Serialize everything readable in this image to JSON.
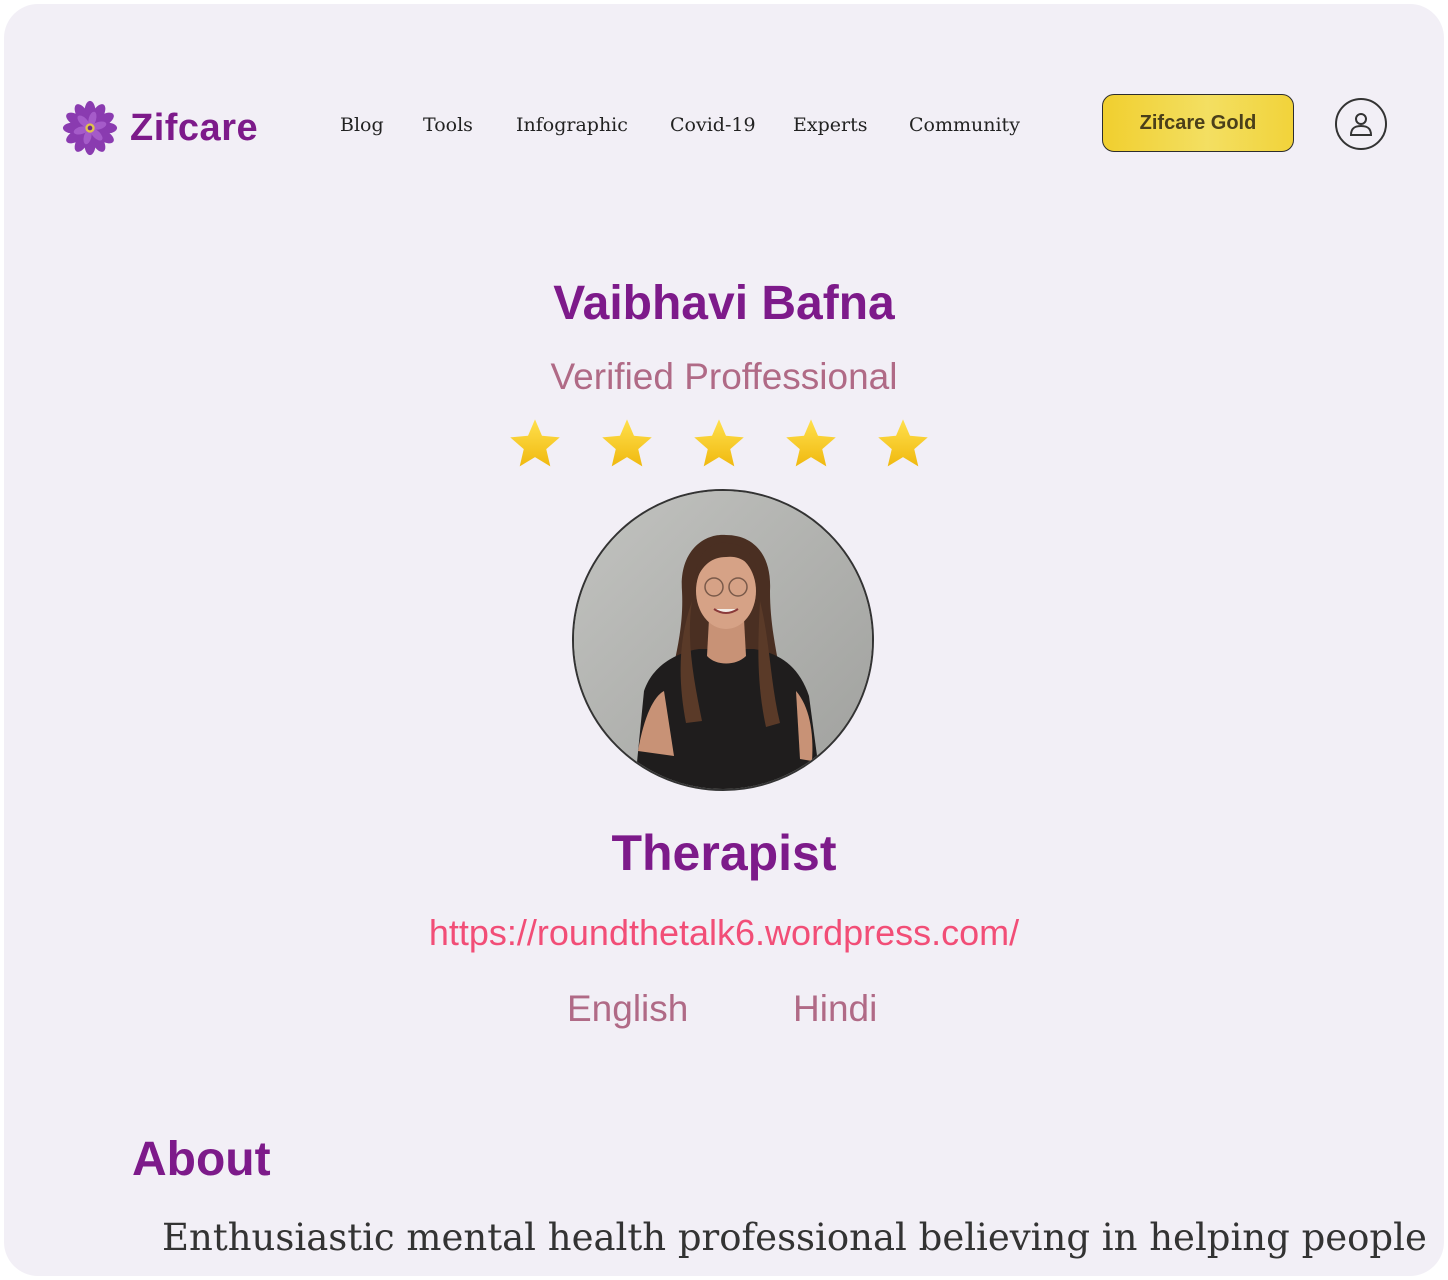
{
  "header": {
    "logo_text": "Zifcare",
    "nav": [
      "Blog",
      "Tools",
      "Infographic",
      "Covid-19",
      "Experts",
      "Community"
    ],
    "gold_button": "Zifcare Gold",
    "user_icon": "user-icon"
  },
  "profile": {
    "name": "Vaibhavi Bafna",
    "status": "Verified Proffessional",
    "rating_stars": 5,
    "role": "Therapist",
    "website": "https://roundthetalk6.wordpress.com/",
    "languages": [
      "English",
      "Hindi"
    ]
  },
  "about": {
    "heading": "About",
    "text": "Enthusiastic mental health professional believing in helping people"
  },
  "colors": {
    "brand": "#7d1a8a",
    "accent_pink": "#f24e77",
    "muted_pink": "#b06a86",
    "gold": "#f1cf2e",
    "background": "#f2eff6"
  }
}
